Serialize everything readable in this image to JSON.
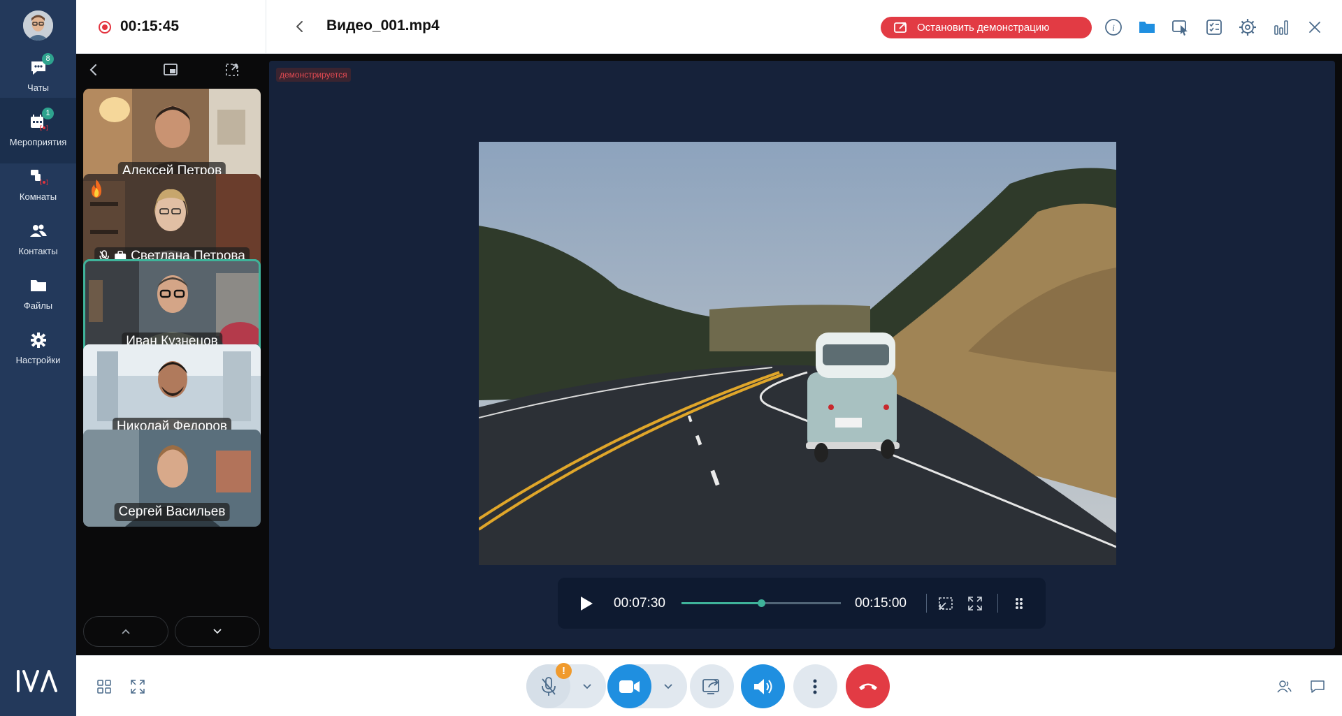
{
  "nav": {
    "items": [
      {
        "label": "Чаты",
        "icon": "chat-icon",
        "badge": "8"
      },
      {
        "label": "Мероприятия",
        "icon": "calendar-icon",
        "badge": "1"
      },
      {
        "label": "Комнаты",
        "icon": "rooms-icon"
      },
      {
        "label": "Контакты",
        "icon": "contacts-icon"
      },
      {
        "label": "Файлы",
        "icon": "folder-icon"
      },
      {
        "label": "Настройки",
        "icon": "gear-icon"
      }
    ],
    "logo": "IVA"
  },
  "header": {
    "recording_time": "00:15:45",
    "file_title": "Видео_001.mp4",
    "stop_label": "Остановить демонстрацию"
  },
  "stage": {
    "demo_badge": "демонстрируется",
    "participants": [
      {
        "name": "Алексей Петров"
      },
      {
        "name": "Светлана Петрова",
        "reaction": "fire-icon",
        "muted": true,
        "presenter": true
      },
      {
        "name": "Иван Кузнецов",
        "speaking": true
      },
      {
        "name": "Николай Федоров"
      },
      {
        "name": "Сергей Васильев"
      }
    ]
  },
  "player": {
    "current_time": "00:07:30",
    "total_time": "00:15:00",
    "progress": 0.5
  },
  "colors": {
    "nav_bg": "#23395b",
    "accent": "#3fb39a",
    "danger": "#e23b44",
    "primary": "#1f8fe0",
    "warning": "#f09a2c"
  }
}
